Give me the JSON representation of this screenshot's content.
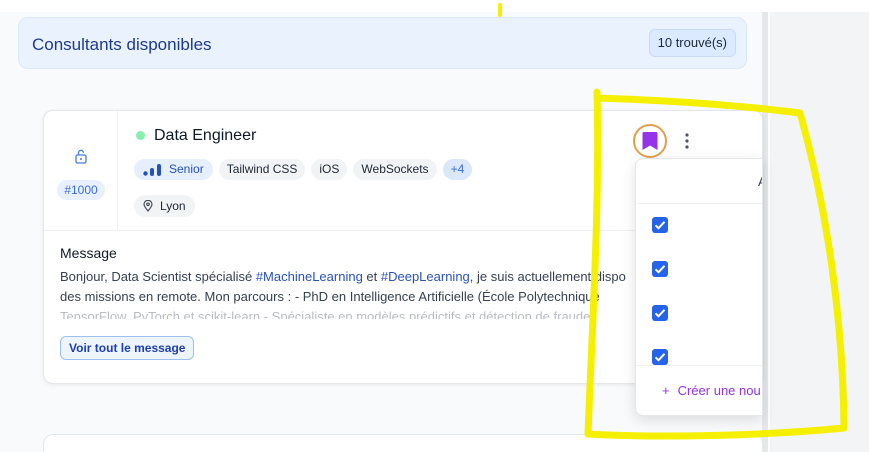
{
  "header": {
    "title": "Consultants disponibles",
    "count": "10 trouvé(s)"
  },
  "card": {
    "id": "#1000",
    "role": "Data Engineer",
    "status_color": "#86efac",
    "level": "Senior",
    "tags": [
      "Tailwind CSS",
      "iOS",
      "WebSockets"
    ],
    "more_tags": "+4",
    "location": "Lyon",
    "message_label": "Message",
    "message_line1_a": "Bonjour, Data Scientist spécialisé ",
    "message_tag1": "#MachineLearning",
    "message_line1_b": " et ",
    "message_tag2": "#DeepLearning",
    "message_line1_c": ", je suis actuellement dispo",
    "message_line2": "des missions en remote. Mon parcours : - PhD en Intelligence Artificielle (École Polytechnique",
    "message_line3": "TensorFlow, PyTorch et scikit-learn - Spécialiste en modèles prédictifs et détection de fraudes",
    "see_all": "Voir tout le message"
  },
  "popover": {
    "header_partial": "A",
    "checked": [
      true,
      true,
      true,
      true
    ],
    "create_label": "Créer une nou",
    "create_icon": "+"
  },
  "colors": {
    "accent": "#2563eb",
    "bookmark": "#9333ea",
    "bookmark_ring": "#e0a04a",
    "highlight": "#f5f000"
  }
}
